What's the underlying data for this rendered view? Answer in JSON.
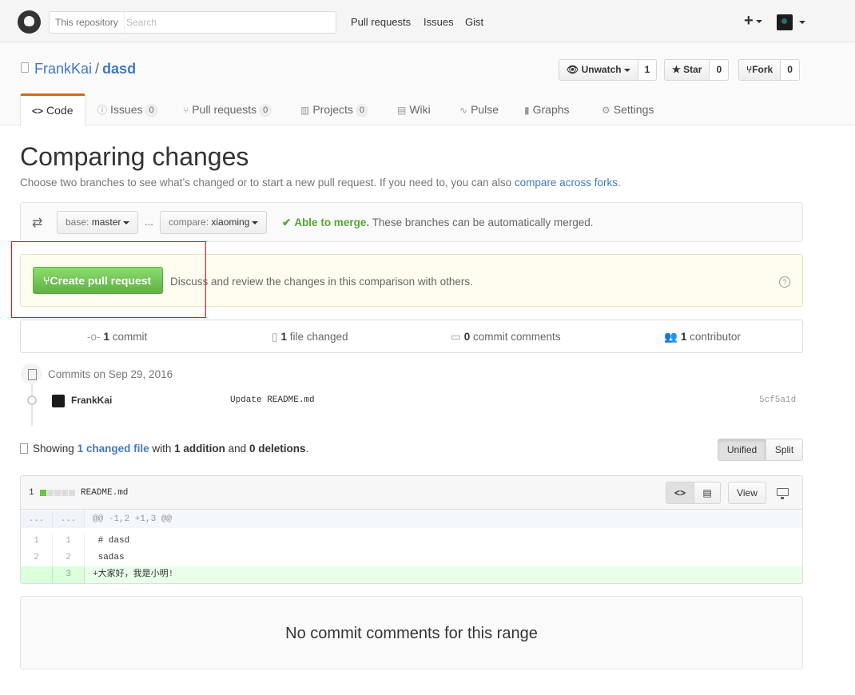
{
  "header": {
    "search_scope": "This repository",
    "search_placeholder": "Search",
    "nav": [
      "Pull requests",
      "Issues",
      "Gist"
    ]
  },
  "repo": {
    "owner": "FrankKai",
    "separator": "/",
    "name": "dasd",
    "watch": {
      "label": "Unwatch",
      "count": "1"
    },
    "star": {
      "label": "Star",
      "count": "0"
    },
    "fork": {
      "label": "Fork",
      "count": "0"
    }
  },
  "tabs": [
    {
      "label": "Code",
      "icon": "code-icon"
    },
    {
      "label": "Issues",
      "count": "0",
      "icon": "issue-icon"
    },
    {
      "label": "Pull requests",
      "count": "0",
      "icon": "pull-request-icon"
    },
    {
      "label": "Projects",
      "count": "0",
      "icon": "project-icon"
    },
    {
      "label": "Wiki",
      "icon": "book-icon"
    },
    {
      "label": "Pulse",
      "icon": "pulse-icon"
    },
    {
      "label": "Graphs",
      "icon": "graph-icon"
    },
    {
      "label": "Settings",
      "icon": "gear-icon"
    }
  ],
  "compare": {
    "title": "Comparing changes",
    "subtitle": "Choose two branches to see what’s changed or to start a new pull request. If you need to, you can also",
    "subtitle_link": "compare across forks",
    "base_prefix": "base:",
    "base_branch": "master",
    "compare_prefix": "compare:",
    "compare_branch": "xiaoming",
    "dots": "...",
    "merge_status": "Able to merge.",
    "merge_text": "These branches can be automatically merged.",
    "create_button": "Create pull request",
    "create_hint": "Discuss and review the changes in this comparison with others."
  },
  "summary": {
    "commits": {
      "count": "1",
      "label": "commit"
    },
    "files": {
      "count": "1",
      "label": "file changed"
    },
    "comments": {
      "count": "0",
      "label": "commit comments"
    },
    "contributors": {
      "count": "1",
      "label": "contributor"
    }
  },
  "commits": {
    "date_label": "Commits on Sep 29, 2016",
    "items": [
      {
        "author": "FrankKai",
        "message": "Update README.md",
        "sha": "5cf5a1d"
      }
    ]
  },
  "diff_summary": {
    "showing": "Showing",
    "changed_link": "1 changed file",
    "with": "with",
    "additions": "1 addition",
    "and": "and",
    "deletions": "0 deletions",
    "unified": "Unified",
    "split": "Split"
  },
  "file": {
    "change_count": "1",
    "name": "README.md",
    "view_label": "View",
    "hunk": "@@ -1,2 +1,3 @@",
    "hunk_left": "...",
    "hunk_right": "...",
    "lines": [
      {
        "a": "1",
        "b": "1",
        "text": " # dasd",
        "type": "context"
      },
      {
        "a": "2",
        "b": "2",
        "text": " sadas",
        "type": "context"
      },
      {
        "a": "",
        "b": "3",
        "text": "+大家好，我是小明!",
        "type": "add"
      }
    ]
  },
  "no_comments": "No commit comments for this range"
}
